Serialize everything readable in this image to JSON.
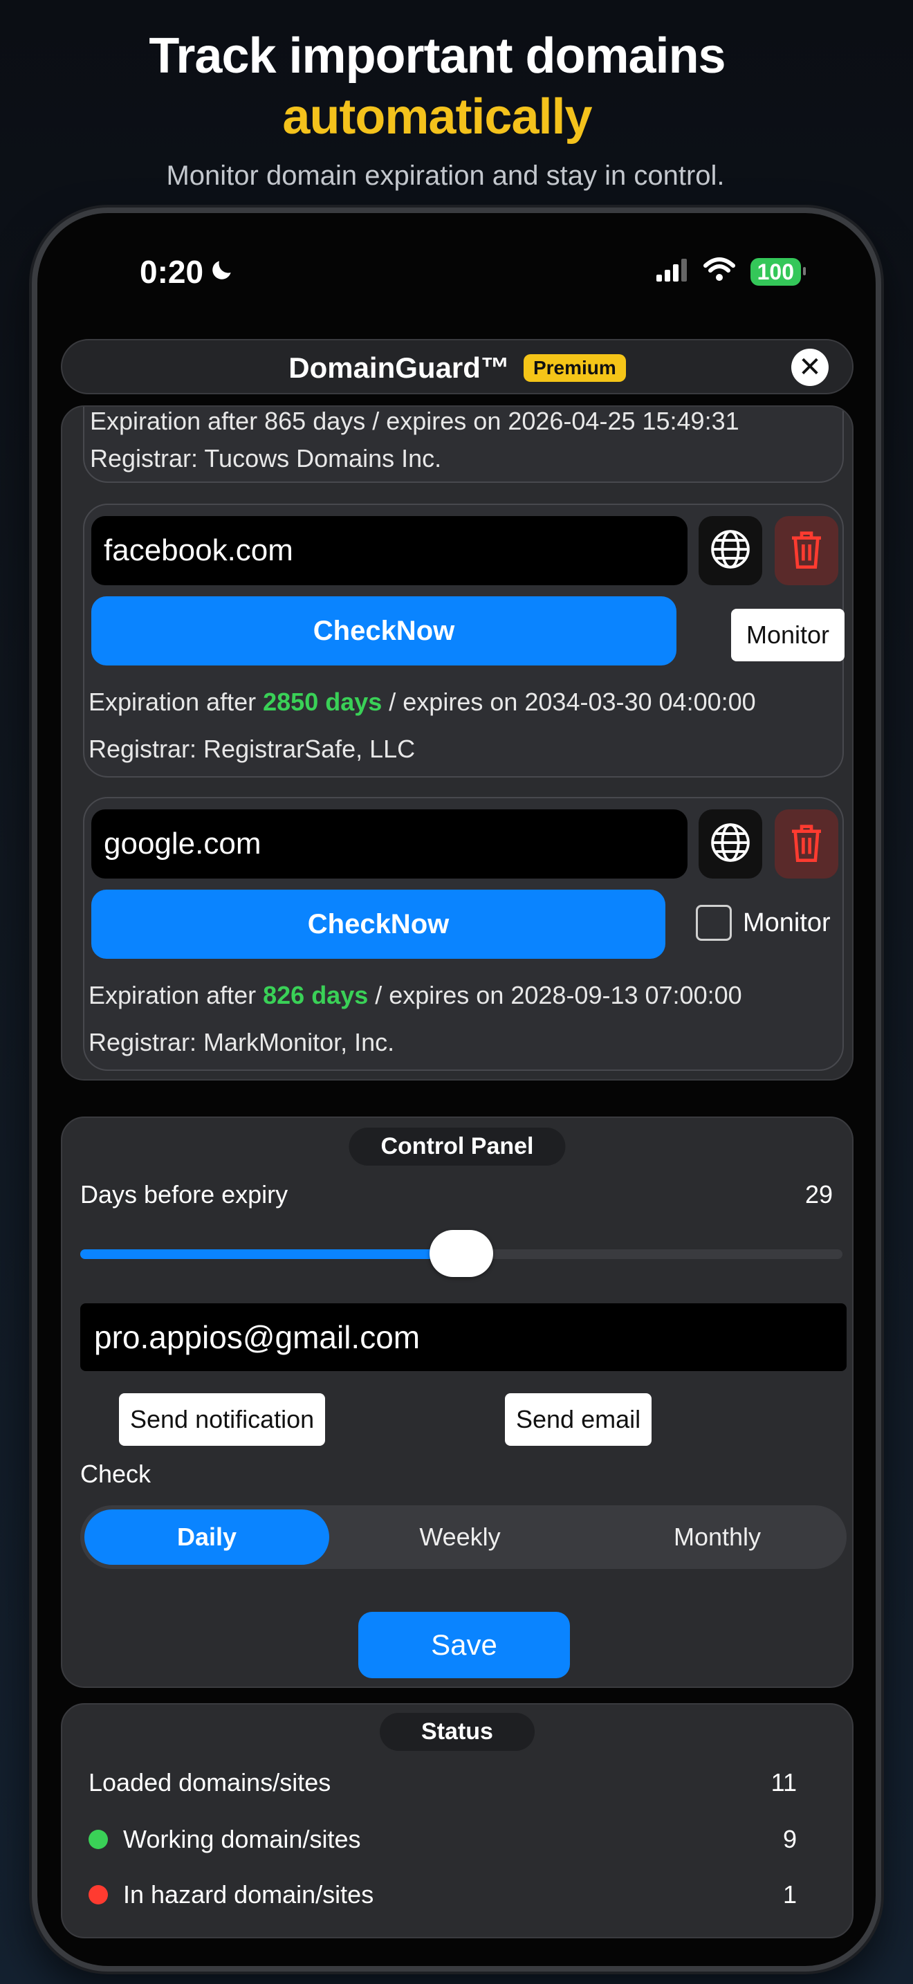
{
  "hero": {
    "title_line1": "Track important domains",
    "title_line2": "automatically",
    "subtitle": "Monitor domain expiration and stay in control.",
    "accent_color": "#f4c21c"
  },
  "status_bar": {
    "time": "0:20",
    "battery": "100"
  },
  "navbar": {
    "title": "DomainGuard™",
    "badge": "Premium"
  },
  "domains_partial": {
    "expiration_line": "Expiration after 865 days / expires on 2026-04-25 15:49:31",
    "registrar": "Registrar: Tucows Domains Inc."
  },
  "domains": [
    {
      "name": "facebook.com",
      "check_label": "CheckNow",
      "monitor_label": "Monitor",
      "exp_prefix": "Expiration after ",
      "exp_days": "2850 days",
      "exp_suffix": " / expires on 2034-03-30 04:00:00",
      "registrar": "Registrar: RegistrarSafe, LLC"
    },
    {
      "name": "google.com",
      "check_label": "CheckNow",
      "monitor_label": "Monitor",
      "exp_prefix": "Expiration after ",
      "exp_days": "826 days",
      "exp_suffix": " / expires on 2028-09-13 07:00:00",
      "registrar": "Registrar: MarkMonitor, Inc."
    }
  ],
  "control_panel": {
    "title": "Control Panel",
    "days_label": "Days before expiry",
    "days_value": "29",
    "slider_fraction": 0.5,
    "email": "pro.appios@gmail.com",
    "send_notification": "Send notification",
    "send_email": "Send email",
    "check_label": "Check",
    "segments": [
      "Daily",
      "Weekly",
      "Monthly"
    ],
    "selected_segment": "Daily",
    "save": "Save"
  },
  "status": {
    "title": "Status",
    "loaded_label": "Loaded domains/sites",
    "loaded_value": "11",
    "working_label": "Working domain/sites",
    "working_value": "9",
    "hazard_label": "In hazard domain/sites",
    "hazard_value": "1"
  },
  "colors": {
    "primary_blue": "#0a84ff",
    "success_green": "#3ad157",
    "danger_red": "#ff3b30",
    "premium_yellow": "#f5c518"
  }
}
